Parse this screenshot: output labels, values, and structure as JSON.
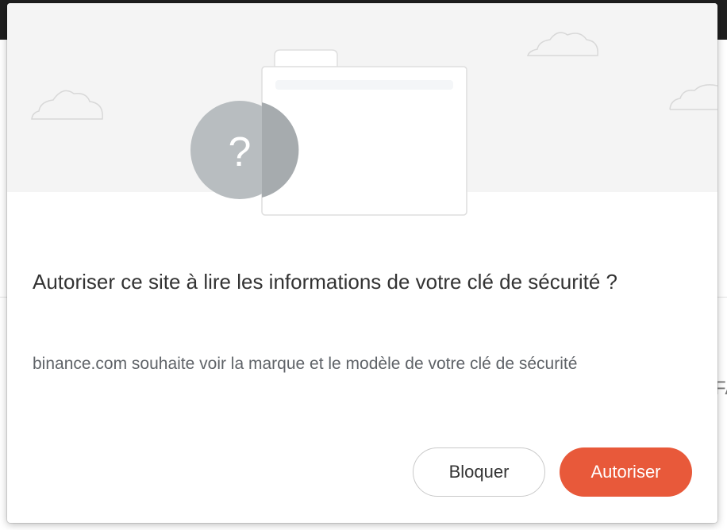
{
  "dialog": {
    "title": "Autoriser ce site à lire les informations de votre clé de sécurité ?",
    "description": "binance.com souhaite voir la marque et le modèle de votre clé de sécurité",
    "block_label": "Bloquer",
    "allow_label": "Autoriser"
  },
  "illustration": {
    "badge_glyph": "?",
    "icons": [
      "cloud-icon",
      "folder-icon",
      "question-badge-icon"
    ]
  },
  "colors": {
    "accent": "#e8593a",
    "illustration_bg": "#f4f4f4",
    "badge": "#a9aeb0"
  }
}
